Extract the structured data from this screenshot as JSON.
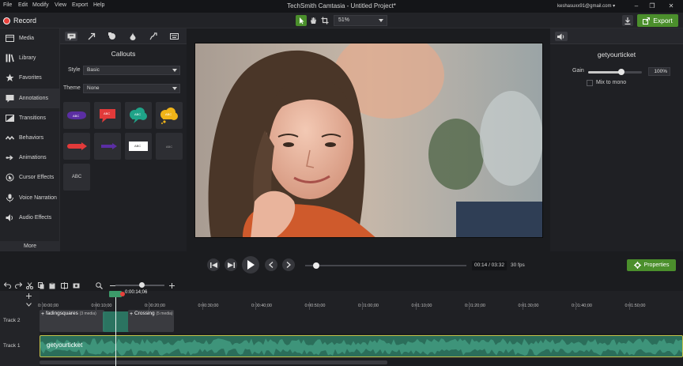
{
  "menu": [
    "File",
    "Edit",
    "Modify",
    "View",
    "Export",
    "Help"
  ],
  "app_title": "TechSmith Camtasia - Untitled Project*",
  "account": "keshasuxx91@gmail.com",
  "window_controls": {
    "minimize": "–",
    "restore": "❐",
    "close": "✕"
  },
  "toolbar": {
    "record_label": "Record",
    "zoom_value": "51%",
    "export_label": "Export",
    "tools": [
      "pointer-icon",
      "hand-icon",
      "crop-icon"
    ]
  },
  "sidebar": {
    "items": [
      {
        "label": "Media",
        "icon": "media-icon"
      },
      {
        "label": "Library",
        "icon": "library-icon"
      },
      {
        "label": "Favorites",
        "icon": "star-icon"
      },
      {
        "label": "Annotations",
        "icon": "annotations-icon"
      },
      {
        "label": "Transitions",
        "icon": "transitions-icon"
      },
      {
        "label": "Behaviors",
        "icon": "behaviors-icon"
      },
      {
        "label": "Animations",
        "icon": "animations-icon"
      },
      {
        "label": "Cursor Effects",
        "icon": "cursor-icon"
      },
      {
        "label": "Voice Narration",
        "icon": "microphone-icon"
      },
      {
        "label": "Audio Effects",
        "icon": "audio-icon"
      }
    ],
    "active_index": 3,
    "more_label": "More"
  },
  "callouts": {
    "title": "Callouts",
    "style_label": "Style",
    "style_value": "Basic",
    "theme_label": "Theme",
    "theme_value": "None",
    "tiles": [
      {
        "text": "ABC"
      },
      {
        "text": "ABC"
      },
      {
        "text": "ABC"
      },
      {
        "text": "ABC"
      },
      {
        "text": ""
      },
      {
        "text": ""
      },
      {
        "text": "ABC"
      },
      {
        "text": "ABC"
      },
      {
        "text": "ABC"
      }
    ]
  },
  "properties": {
    "clip_name": "getyourticket",
    "gain_label": "Gain",
    "gain_value": "100%",
    "gain_fraction": 0.62,
    "mix_to_mono_label": "Mix to mono",
    "properties_button": "Properties"
  },
  "playback": {
    "timecode": "00:14 / 03:32",
    "fps": "30 fps",
    "progress_fraction": 0.07
  },
  "timeline": {
    "playhead_time": "0:00:14;06",
    "ruler_labels": [
      "0:00:00;00",
      "0:00:10;00",
      "0:00:20;00",
      "0:00:30;00",
      "0:00:40;00",
      "0:00:50;00",
      "0:01:00;00",
      "0:01:10;00",
      "0:01:20;00",
      "0:01:30;00",
      "0:01:40;00",
      "0:01:50;00"
    ],
    "tracks": [
      {
        "label": "Track 2",
        "clips": [
          {
            "label": "fadingsquares",
            "tag": "(3 media)"
          },
          {
            "label": "Crossing",
            "tag": "(5 media)"
          }
        ]
      },
      {
        "label": "Track 1",
        "clips": [
          {
            "label": "getyourticket"
          }
        ]
      }
    ]
  }
}
